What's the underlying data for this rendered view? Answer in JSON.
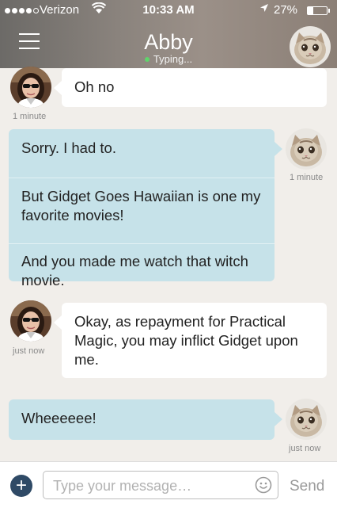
{
  "status_bar": {
    "carrier": "Verizon",
    "time": "10:33 AM",
    "battery": "27%",
    "battery_level": 0.27,
    "icons": [
      "signal-dots-icon",
      "wifi-icon",
      "location-arrow-icon",
      "battery-icon"
    ]
  },
  "header": {
    "title": "Abby",
    "status": "Typing...",
    "menu_icon": "hamburger-menu-icon",
    "avatar": "kitten-avatar"
  },
  "messages": [
    {
      "side": "incoming",
      "avatar": "woman-avatar",
      "time": "1 minute",
      "texts": [
        "Oh no"
      ]
    },
    {
      "side": "outgoing",
      "avatar": "kitten-avatar",
      "time": "1 minute",
      "texts": [
        "Sorry. I had to.",
        "But Gidget Goes Hawaiian is one my favorite movies!",
        "And you made me watch that witch movie."
      ]
    },
    {
      "side": "incoming",
      "avatar": "woman-avatar",
      "time": "just now",
      "texts": [
        "Okay, as repayment for Practical Magic, you may inflict Gidget upon me."
      ]
    },
    {
      "side": "outgoing",
      "avatar": "kitten-avatar",
      "time": "just now",
      "texts": [
        "Wheeeeee!"
      ]
    }
  ],
  "composer": {
    "placeholder": "Type your message…",
    "value": "",
    "send_label": "Send",
    "add_icon": "plus-circle-icon",
    "emoji_icon": "smiley-icon"
  },
  "colors": {
    "background": "#f1eeea",
    "incoming_bubble": "#ffffff",
    "outgoing_bubble": "#c6e2e9",
    "typing_dot": "#5fd46b",
    "add_button": "#2f4a66"
  }
}
